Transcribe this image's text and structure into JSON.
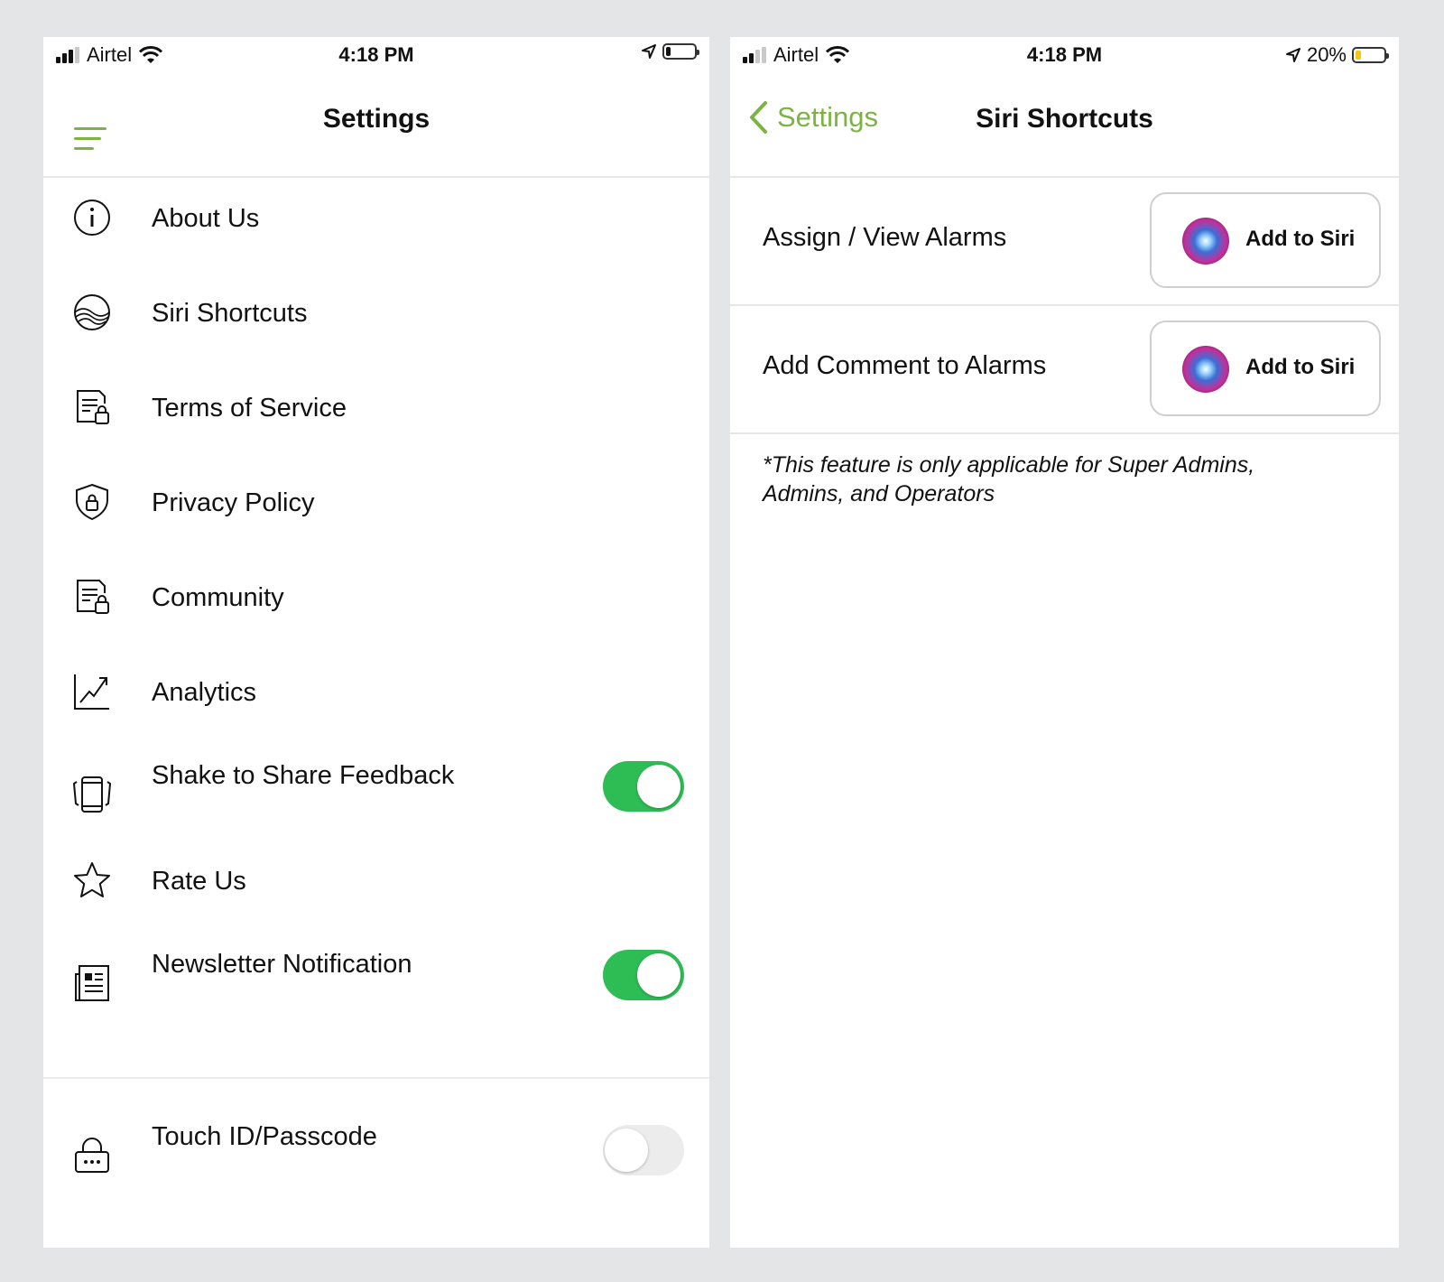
{
  "left_screen": {
    "status": {
      "carrier": "Airtel",
      "time": "4:18 PM"
    },
    "nav": {
      "title": "Settings"
    },
    "items": [
      {
        "label": "About Us"
      },
      {
        "label": "Siri Shortcuts"
      },
      {
        "label": "Terms of Service"
      },
      {
        "label": "Privacy Policy"
      },
      {
        "label": "Community"
      },
      {
        "label": "Analytics"
      },
      {
        "label": "Shake to Share Feedback",
        "toggle": "on"
      },
      {
        "label": "Rate Us"
      },
      {
        "label": "Newsletter Notification",
        "toggle": "on"
      },
      {
        "label": "Touch ID/Passcode",
        "toggle": "off"
      }
    ]
  },
  "right_screen": {
    "status": {
      "carrier": "Airtel",
      "time": "4:18 PM",
      "battery": "20%"
    },
    "nav": {
      "back_label": "Settings",
      "title": "Siri Shortcuts"
    },
    "shortcuts": [
      {
        "label": "Assign / View Alarms",
        "button": "Add to Siri"
      },
      {
        "label": "Add Comment to Alarms",
        "button": "Add to Siri"
      }
    ],
    "note": "*This feature is only applicable for Super Admins, Admins, and Operators"
  },
  "colors": {
    "accent": "#7db343",
    "toggle_on": "#2ebd54",
    "toggle_off": "#ececec",
    "battery_low": "#f5c518"
  },
  "battery_level": {
    "left": 0.15,
    "right": 0.2
  }
}
